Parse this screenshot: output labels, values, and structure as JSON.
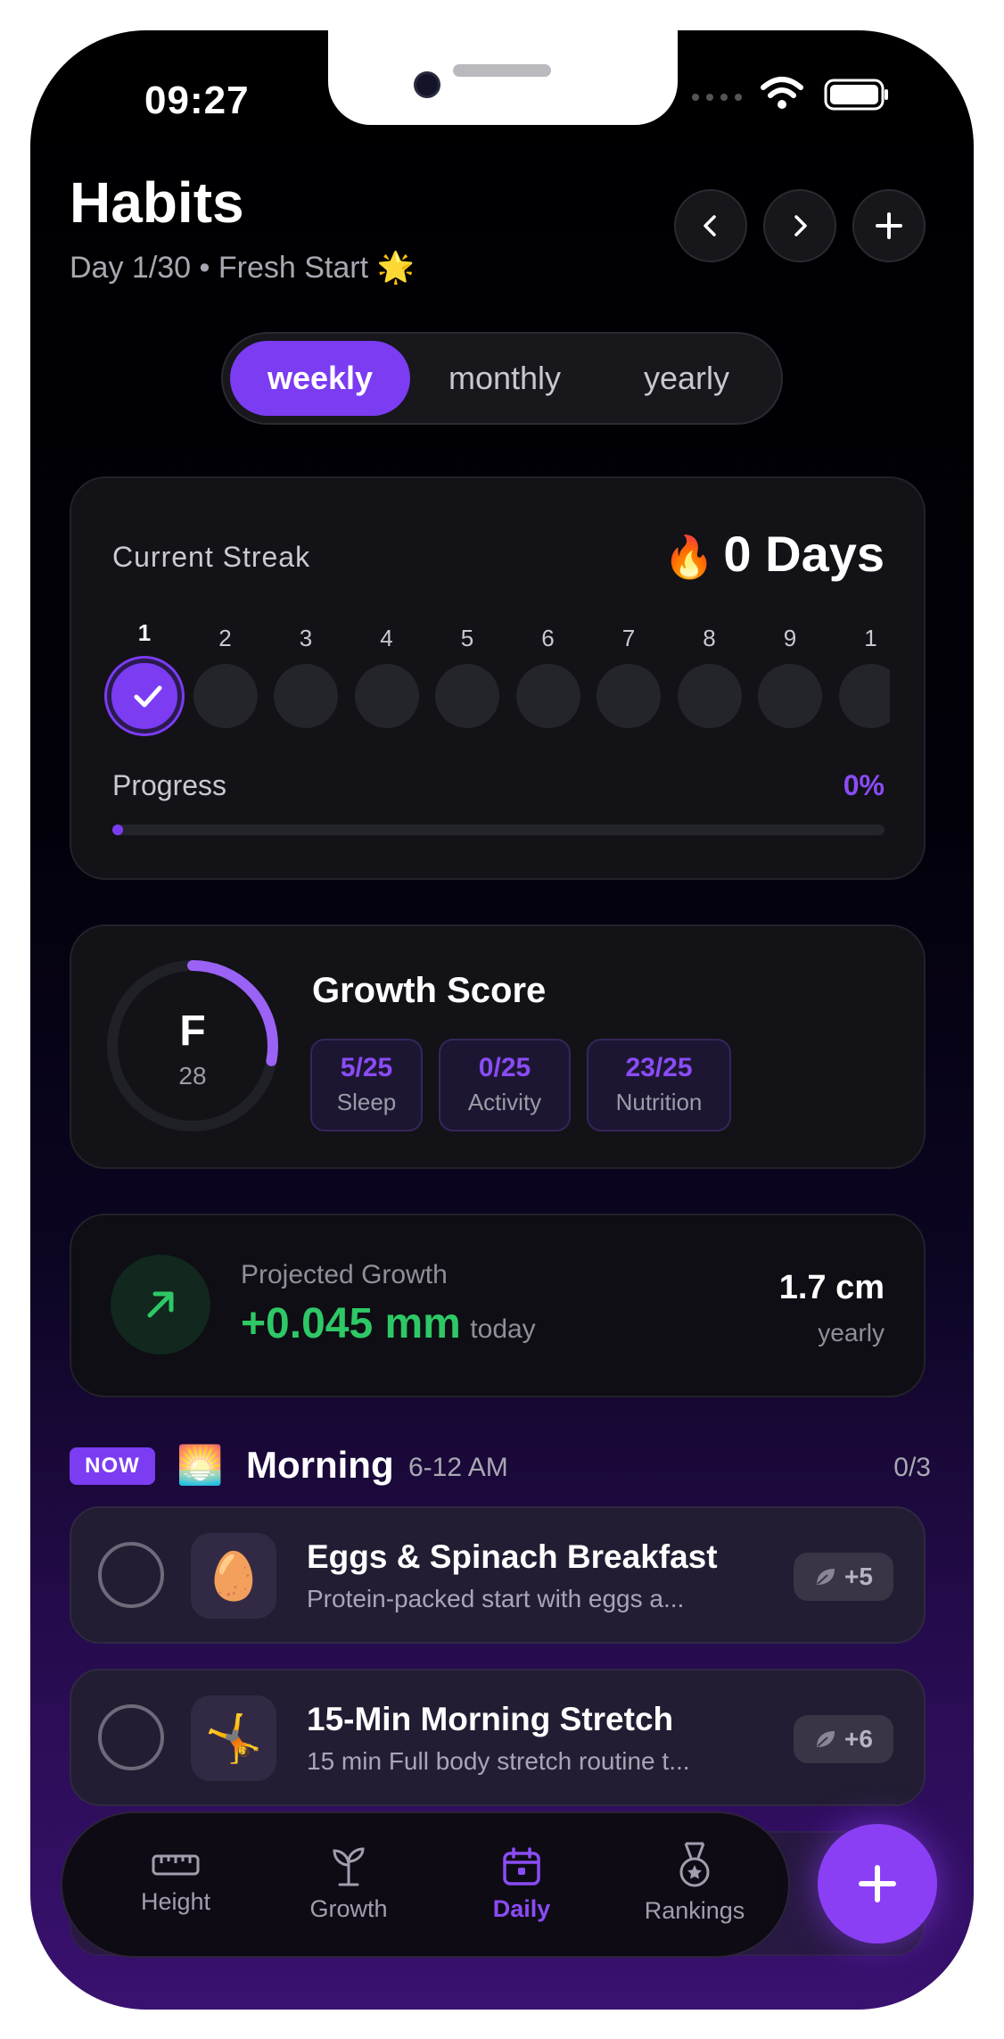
{
  "status_bar": {
    "time": "09:27"
  },
  "header": {
    "title": "Habits",
    "subtitle": "Day 1/30 • Fresh Start",
    "subtitle_emoji": "🌟"
  },
  "period_tabs": [
    {
      "label": "weekly",
      "active": true
    },
    {
      "label": "monthly",
      "active": false
    },
    {
      "label": "yearly",
      "active": false
    }
  ],
  "streak": {
    "label": "Current Streak",
    "emoji": "🔥",
    "value": "0 Days",
    "days": [
      "1",
      "2",
      "3",
      "4",
      "5",
      "6",
      "7",
      "8",
      "9",
      "1"
    ],
    "completed_days": [
      1
    ],
    "progress_label": "Progress",
    "progress_value": "0%",
    "progress_fraction": 0
  },
  "growth_score": {
    "title": "Growth Score",
    "grade": "F",
    "score": "28",
    "ring_fraction": 0.28,
    "metrics": [
      {
        "value": "5/25",
        "label": "Sleep"
      },
      {
        "value": "0/25",
        "label": "Activity"
      },
      {
        "value": "23/25",
        "label": "Nutrition"
      }
    ]
  },
  "projection": {
    "label": "Projected Growth",
    "value": "+0.045 mm",
    "period": "today",
    "yearly_value": "1.7 cm",
    "yearly_label": "yearly"
  },
  "section": {
    "now_badge": "NOW",
    "emoji": "🌅",
    "title": "Morning",
    "time_range": "6-12 AM",
    "count": "0/3"
  },
  "habits": [
    {
      "emoji": "🥚",
      "title": "Eggs & Spinach Breakfast",
      "subtitle": "Protein-packed start with eggs a...",
      "points": "+5"
    },
    {
      "emoji": "🤸",
      "title": "15-Min Morning Stretch",
      "subtitle": "15 min  Full body stretch routine t...",
      "points": "+6"
    }
  ],
  "nav": {
    "items": [
      {
        "label": "Height",
        "icon": "ruler-icon",
        "active": false
      },
      {
        "label": "Growth",
        "icon": "sprout-icon",
        "active": false
      },
      {
        "label": "Daily",
        "icon": "calendar-icon",
        "active": true
      },
      {
        "label": "Rankings",
        "icon": "medal-icon",
        "active": false
      }
    ]
  },
  "colors": {
    "accent": "#7b3cf2",
    "green": "#2ec866",
    "bg": "#000000"
  }
}
